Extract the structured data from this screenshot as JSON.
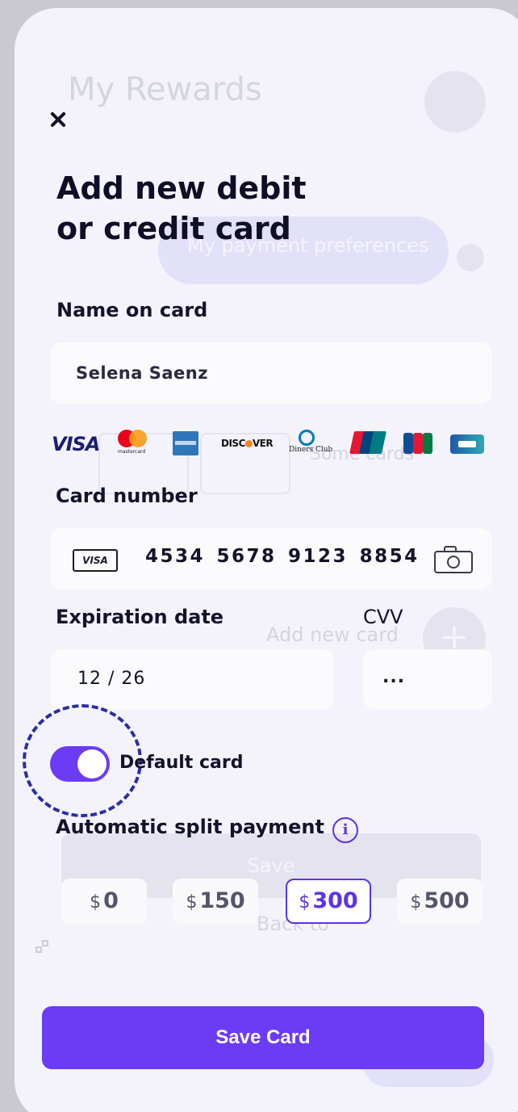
{
  "background": {
    "title": "My Rewards",
    "pill_label": "My payment preferences",
    "cards_text": "Some cards",
    "add_new": "Add new card",
    "plus": "+",
    "save": "Save",
    "back": "Back to"
  },
  "sheet": {
    "title_line1": "Add new debit",
    "title_line2": "or credit card",
    "name": {
      "label": "Name on card",
      "value": "Selena Saenz"
    },
    "brands": {
      "visa": "VISA",
      "mastercard": "mastercard",
      "discover_left": "DISC",
      "discover_right": "VER",
      "diners": "Diners Club"
    },
    "card_number": {
      "label": "Card number",
      "brand_badge": "VISA",
      "value": "4534 5678 9123 8854"
    },
    "expiration": {
      "label": "Expiration date",
      "value": "12 / 26"
    },
    "cvv": {
      "label": "CVV",
      "value": "..."
    },
    "default_card": {
      "label": "Default card",
      "enabled": true
    },
    "split_payment": {
      "label": "Automatic split payment",
      "info_glyph": "i",
      "currency": "$",
      "options": [
        "0",
        "150",
        "300",
        "500"
      ],
      "selected": "300"
    },
    "save_button": "Save Card"
  },
  "colors": {
    "accent": "#6b3bf5",
    "selected_outline": "#5b32e6",
    "focus_ring": "#2a2ca8",
    "sheet_bg": "#f4f3fb"
  },
  "icons": {
    "close": "close-icon",
    "camera": "camera-icon",
    "info": "info-icon"
  }
}
